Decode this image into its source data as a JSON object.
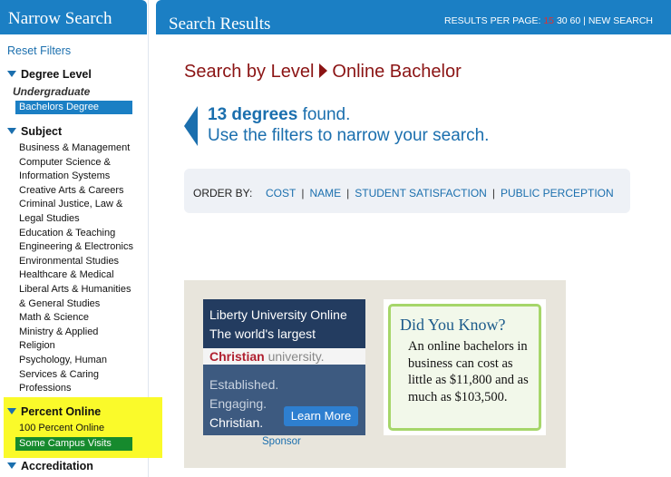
{
  "sidebar": {
    "title": "Narrow Search",
    "reset": "Reset Filters",
    "degree_level": {
      "heading": "Degree Level",
      "group": "Undergraduate",
      "selected": "Bachelors Degree"
    },
    "subject": {
      "heading": "Subject",
      "items": [
        "Business & Management",
        "Computer Science &",
        "Information Systems",
        "Creative Arts & Careers",
        "Criminal Justice, Law &",
        "Legal Studies",
        "Education & Teaching",
        "Engineering & Electronics",
        "Environmental Studies",
        "Healthcare & Medical",
        "Liberal Arts & Humanities",
        "& General Studies",
        "Math & Science",
        "Ministry & Applied",
        "Religion",
        "Psychology, Human",
        "Services & Caring",
        "Professions"
      ]
    },
    "percent_online": {
      "heading": "Percent Online",
      "item": "100 Percent Online",
      "selected": "Some Campus Visits"
    },
    "accreditation": {
      "heading": "Accreditation"
    },
    "colors": {
      "accent": "#1b7fc4",
      "highlight": "#fafa2a",
      "selected_green": "#168a2d"
    }
  },
  "header": {
    "title": "Search Results",
    "results_per_page_label": "RESULTS PER PAGE:",
    "rpp_current": "15",
    "rpp_options": [
      "30",
      "60"
    ],
    "new_search": "NEW SEARCH"
  },
  "breadcrumb": {
    "part1": "Search by Level",
    "part2": "Online Bachelor"
  },
  "results": {
    "count": "13 degrees",
    "found": "found.",
    "hint": "Use the filters to narrow your search."
  },
  "order": {
    "label": "ORDER BY:",
    "options": [
      "COST",
      "NAME",
      "STUDENT SATISFACTION",
      "PUBLIC PERCEPTION"
    ]
  },
  "ads": {
    "liberty": {
      "line1": "Liberty University Online",
      "line2": "The world's largest",
      "line3a": "Christian",
      "line3b": " university.",
      "line4": "Established.",
      "line5": "Engaging.",
      "line6": "Christian.",
      "button": "Learn More"
    },
    "sponsor": "Sponsor",
    "did_you_know": {
      "heading": "Did You Know?",
      "body": "An online bachelors in business can cost as little as $11,800 and as much as $103,500."
    }
  }
}
